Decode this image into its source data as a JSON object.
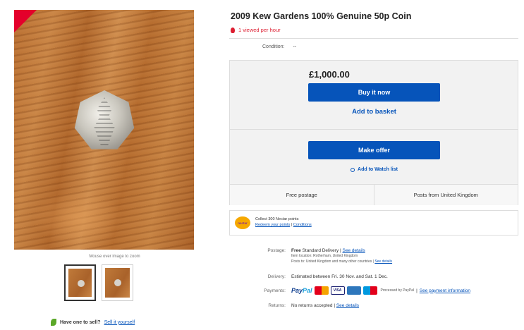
{
  "gallery": {
    "zoom_hint": "Mouse over image to zoom",
    "sell": {
      "prompt": "Have one to sell?",
      "link": "Sell it yourself"
    }
  },
  "listing": {
    "title": "2009 Kew Gardens 100% Genuine 50p Coin",
    "viewed": "1 viewed per hour",
    "condition_label": "Condition:",
    "condition_value": "--"
  },
  "buybox": {
    "price": "£1,000.00",
    "buy_now": "Buy it now",
    "add_basket": "Add to basket",
    "make_offer": "Make offer",
    "watch": "Add to Watch list",
    "free_postage": "Free postage",
    "posts_from": "Posts from United Kingdom"
  },
  "nectar": {
    "logo": "nectar",
    "line1": "Collect 300 Nectar points",
    "redeem": "Redeem your points",
    "sep": "|",
    "conditions": "Conditions"
  },
  "details": {
    "postage_label": "Postage:",
    "postage_free": "Free",
    "postage_method": "Standard Delivery |",
    "postage_link": "See details",
    "item_location": "Item location: Rotherham, United Kingdom",
    "posts_to": "Posts to: United Kingdom and many other countries |",
    "posts_to_link": "See details",
    "delivery_label": "Delivery:",
    "delivery_value": "Estimated between Fri. 30 Nov. and Sat. 1 Dec.",
    "payments_label": "Payments:",
    "paypal_a": "Pay",
    "paypal_b": "Pal",
    "visa": "VISA",
    "processed": "Processed by PayPal",
    "payment_link": "See payment information",
    "payment_sep": "|",
    "returns_label": "Returns:",
    "returns_value": "No returns accepted |",
    "returns_link": "See details"
  },
  "colors": {
    "accent_blue": "#0654ba",
    "alert_red": "#dd1e31",
    "ribbon_red": "#e4002b"
  }
}
